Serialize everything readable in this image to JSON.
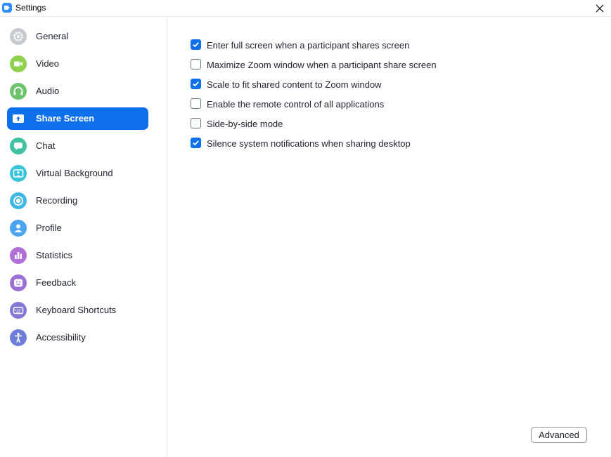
{
  "window": {
    "title": "Settings",
    "accent_color": "#0e71eb"
  },
  "sidebar": {
    "active_index": 3,
    "items": [
      {
        "label": "General",
        "icon": "gear-icon",
        "color": "#c9c9d1"
      },
      {
        "label": "Video",
        "icon": "video-camera-icon",
        "color": "#8fd04f"
      },
      {
        "label": "Audio",
        "icon": "headphones-icon",
        "color": "#6cc36c"
      },
      {
        "label": "Share Screen",
        "icon": "share-screen-icon",
        "color": "#0e71eb"
      },
      {
        "label": "Chat",
        "icon": "chat-bubble-icon",
        "color": "#3fc2a4"
      },
      {
        "label": "Virtual Background",
        "icon": "virtual-background-icon",
        "color": "#38c4d8"
      },
      {
        "label": "Recording",
        "icon": "record-icon",
        "color": "#3fb7e6"
      },
      {
        "label": "Profile",
        "icon": "person-icon",
        "color": "#4aa5f0"
      },
      {
        "label": "Statistics",
        "icon": "bar-chart-icon",
        "color": "#b26fd6"
      },
      {
        "label": "Feedback",
        "icon": "smiley-icon",
        "color": "#9b6fd6"
      },
      {
        "label": "Keyboard Shortcuts",
        "icon": "keyboard-icon",
        "color": "#8478d6"
      },
      {
        "label": "Accessibility",
        "icon": "accessibility-icon",
        "color": "#6e7ed8"
      }
    ]
  },
  "share_screen": {
    "options": [
      {
        "label": "Enter full screen when a participant shares screen",
        "checked": true
      },
      {
        "label": "Maximize Zoom window when a participant share screen",
        "checked": false
      },
      {
        "label": "Scale to fit shared content to Zoom window",
        "checked": true
      },
      {
        "label": "Enable the remote control of all applications",
        "checked": false
      },
      {
        "label": "Side-by-side mode",
        "checked": false
      },
      {
        "label": "Silence system notifications when sharing desktop",
        "checked": true
      }
    ],
    "advanced_label": "Advanced"
  }
}
